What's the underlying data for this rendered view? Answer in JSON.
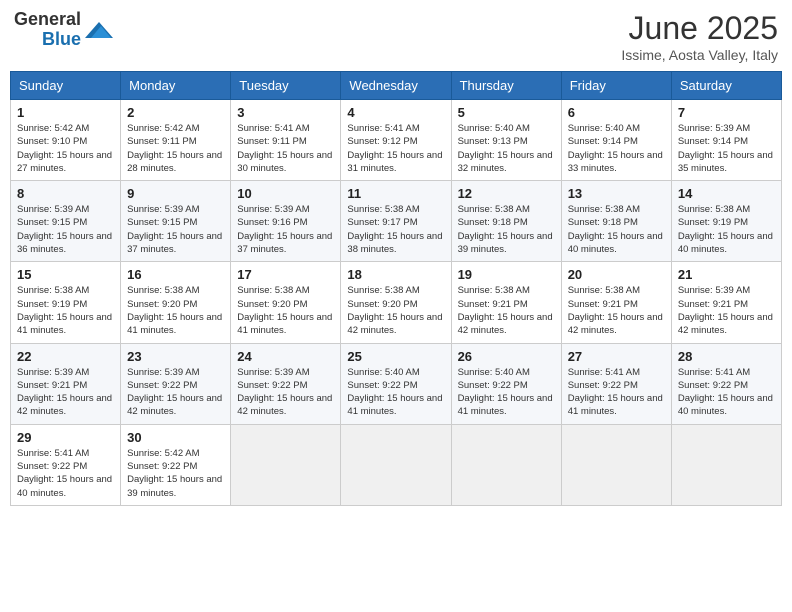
{
  "header": {
    "logo_general": "General",
    "logo_blue": "Blue",
    "month_title": "June 2025",
    "location": "Issime, Aosta Valley, Italy"
  },
  "days_of_week": [
    "Sunday",
    "Monday",
    "Tuesday",
    "Wednesday",
    "Thursday",
    "Friday",
    "Saturday"
  ],
  "weeks": [
    [
      {
        "day": "1",
        "sunrise": "5:42 AM",
        "sunset": "9:10 PM",
        "daylight": "15 hours and 27 minutes."
      },
      {
        "day": "2",
        "sunrise": "5:42 AM",
        "sunset": "9:11 PM",
        "daylight": "15 hours and 28 minutes."
      },
      {
        "day": "3",
        "sunrise": "5:41 AM",
        "sunset": "9:11 PM",
        "daylight": "15 hours and 30 minutes."
      },
      {
        "day": "4",
        "sunrise": "5:41 AM",
        "sunset": "9:12 PM",
        "daylight": "15 hours and 31 minutes."
      },
      {
        "day": "5",
        "sunrise": "5:40 AM",
        "sunset": "9:13 PM",
        "daylight": "15 hours and 32 minutes."
      },
      {
        "day": "6",
        "sunrise": "5:40 AM",
        "sunset": "9:14 PM",
        "daylight": "15 hours and 33 minutes."
      },
      {
        "day": "7",
        "sunrise": "5:39 AM",
        "sunset": "9:14 PM",
        "daylight": "15 hours and 35 minutes."
      }
    ],
    [
      {
        "day": "8",
        "sunrise": "5:39 AM",
        "sunset": "9:15 PM",
        "daylight": "15 hours and 36 minutes."
      },
      {
        "day": "9",
        "sunrise": "5:39 AM",
        "sunset": "9:15 PM",
        "daylight": "15 hours and 37 minutes."
      },
      {
        "day": "10",
        "sunrise": "5:39 AM",
        "sunset": "9:16 PM",
        "daylight": "15 hours and 37 minutes."
      },
      {
        "day": "11",
        "sunrise": "5:38 AM",
        "sunset": "9:17 PM",
        "daylight": "15 hours and 38 minutes."
      },
      {
        "day": "12",
        "sunrise": "5:38 AM",
        "sunset": "9:18 PM",
        "daylight": "15 hours and 39 minutes."
      },
      {
        "day": "13",
        "sunrise": "5:38 AM",
        "sunset": "9:18 PM",
        "daylight": "15 hours and 40 minutes."
      },
      {
        "day": "14",
        "sunrise": "5:38 AM",
        "sunset": "9:19 PM",
        "daylight": "15 hours and 40 minutes."
      }
    ],
    [
      {
        "day": "15",
        "sunrise": "5:38 AM",
        "sunset": "9:19 PM",
        "daylight": "15 hours and 41 minutes."
      },
      {
        "day": "16",
        "sunrise": "5:38 AM",
        "sunset": "9:20 PM",
        "daylight": "15 hours and 41 minutes."
      },
      {
        "day": "17",
        "sunrise": "5:38 AM",
        "sunset": "9:20 PM",
        "daylight": "15 hours and 41 minutes."
      },
      {
        "day": "18",
        "sunrise": "5:38 AM",
        "sunset": "9:20 PM",
        "daylight": "15 hours and 42 minutes."
      },
      {
        "day": "19",
        "sunrise": "5:38 AM",
        "sunset": "9:21 PM",
        "daylight": "15 hours and 42 minutes."
      },
      {
        "day": "20",
        "sunrise": "5:38 AM",
        "sunset": "9:21 PM",
        "daylight": "15 hours and 42 minutes."
      },
      {
        "day": "21",
        "sunrise": "5:39 AM",
        "sunset": "9:21 PM",
        "daylight": "15 hours and 42 minutes."
      }
    ],
    [
      {
        "day": "22",
        "sunrise": "5:39 AM",
        "sunset": "9:21 PM",
        "daylight": "15 hours and 42 minutes."
      },
      {
        "day": "23",
        "sunrise": "5:39 AM",
        "sunset": "9:22 PM",
        "daylight": "15 hours and 42 minutes."
      },
      {
        "day": "24",
        "sunrise": "5:39 AM",
        "sunset": "9:22 PM",
        "daylight": "15 hours and 42 minutes."
      },
      {
        "day": "25",
        "sunrise": "5:40 AM",
        "sunset": "9:22 PM",
        "daylight": "15 hours and 41 minutes."
      },
      {
        "day": "26",
        "sunrise": "5:40 AM",
        "sunset": "9:22 PM",
        "daylight": "15 hours and 41 minutes."
      },
      {
        "day": "27",
        "sunrise": "5:41 AM",
        "sunset": "9:22 PM",
        "daylight": "15 hours and 41 minutes."
      },
      {
        "day": "28",
        "sunrise": "5:41 AM",
        "sunset": "9:22 PM",
        "daylight": "15 hours and 40 minutes."
      }
    ],
    [
      {
        "day": "29",
        "sunrise": "5:41 AM",
        "sunset": "9:22 PM",
        "daylight": "15 hours and 40 minutes."
      },
      {
        "day": "30",
        "sunrise": "5:42 AM",
        "sunset": "9:22 PM",
        "daylight": "15 hours and 39 minutes."
      },
      null,
      null,
      null,
      null,
      null
    ]
  ],
  "labels": {
    "sunrise": "Sunrise:",
    "sunset": "Sunset:",
    "daylight": "Daylight:"
  }
}
